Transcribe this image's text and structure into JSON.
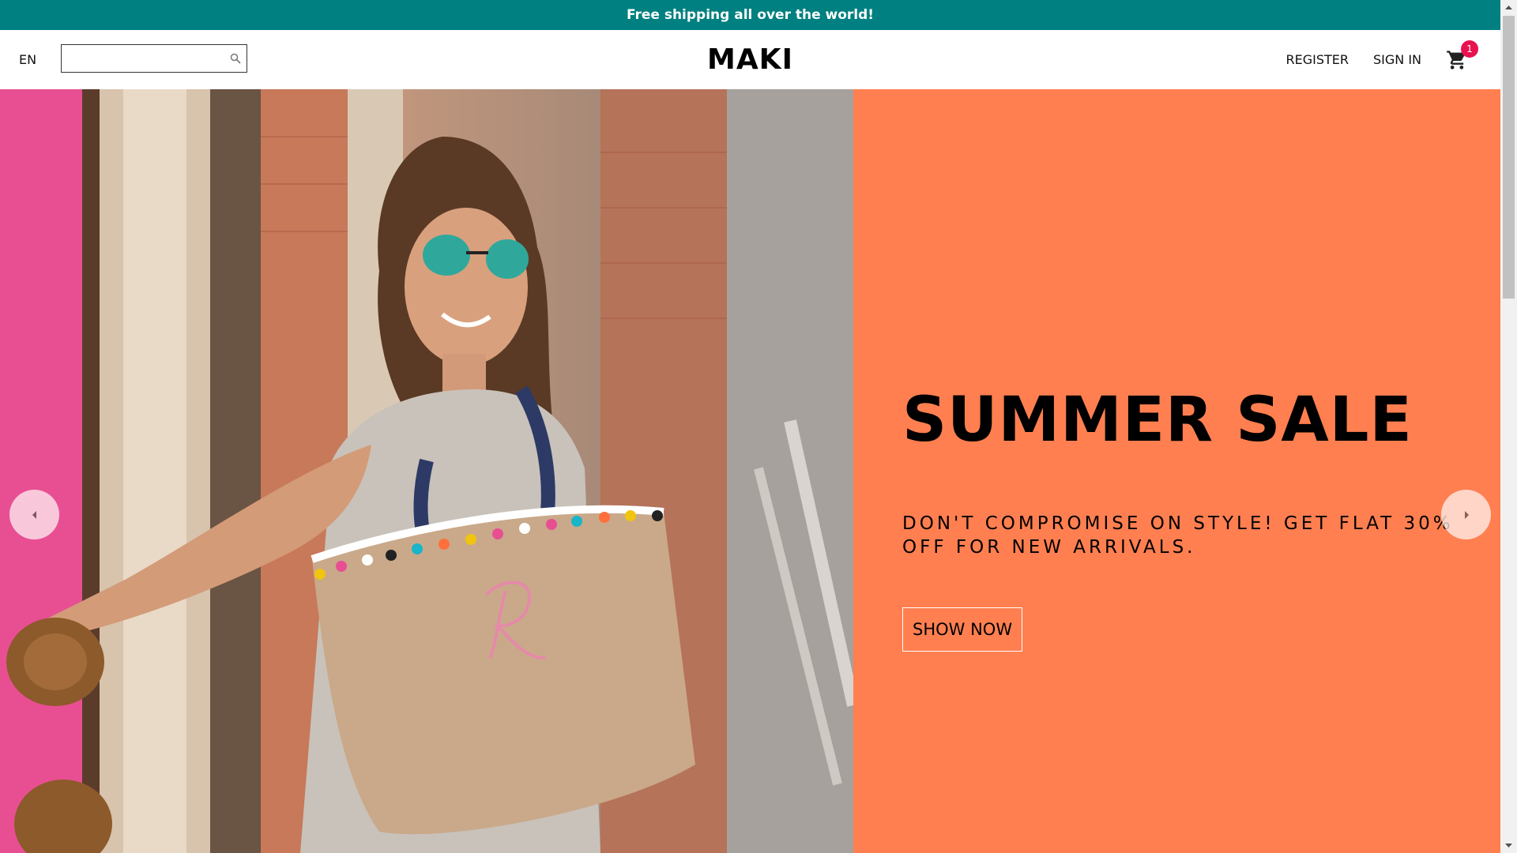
{
  "announcement": {
    "text": "Free shipping all over the world!"
  },
  "navbar": {
    "language": "EN",
    "search": {
      "value": "",
      "placeholder": ""
    },
    "logo": "MAKI",
    "register_label": "REGISTER",
    "signin_label": "SIGN IN",
    "cart_count": "1"
  },
  "slider": {
    "image": "woman with straw pom-pom tote bag, monogram R",
    "title": "SUMMER SALE",
    "description": "DON'T COMPROMISE ON STYLE! GET FLAT 30% OFF FOR NEW ARRIVALS.",
    "button_label": "SHOW NOW",
    "background_color": "#ff7f50"
  },
  "icons": {
    "search": "search-icon",
    "cart": "cart-icon",
    "prev": "chevron-left-icon",
    "next": "chevron-right-icon"
  },
  "colors": {
    "announcement_bg": "#008080",
    "badge": "#e8124f"
  }
}
